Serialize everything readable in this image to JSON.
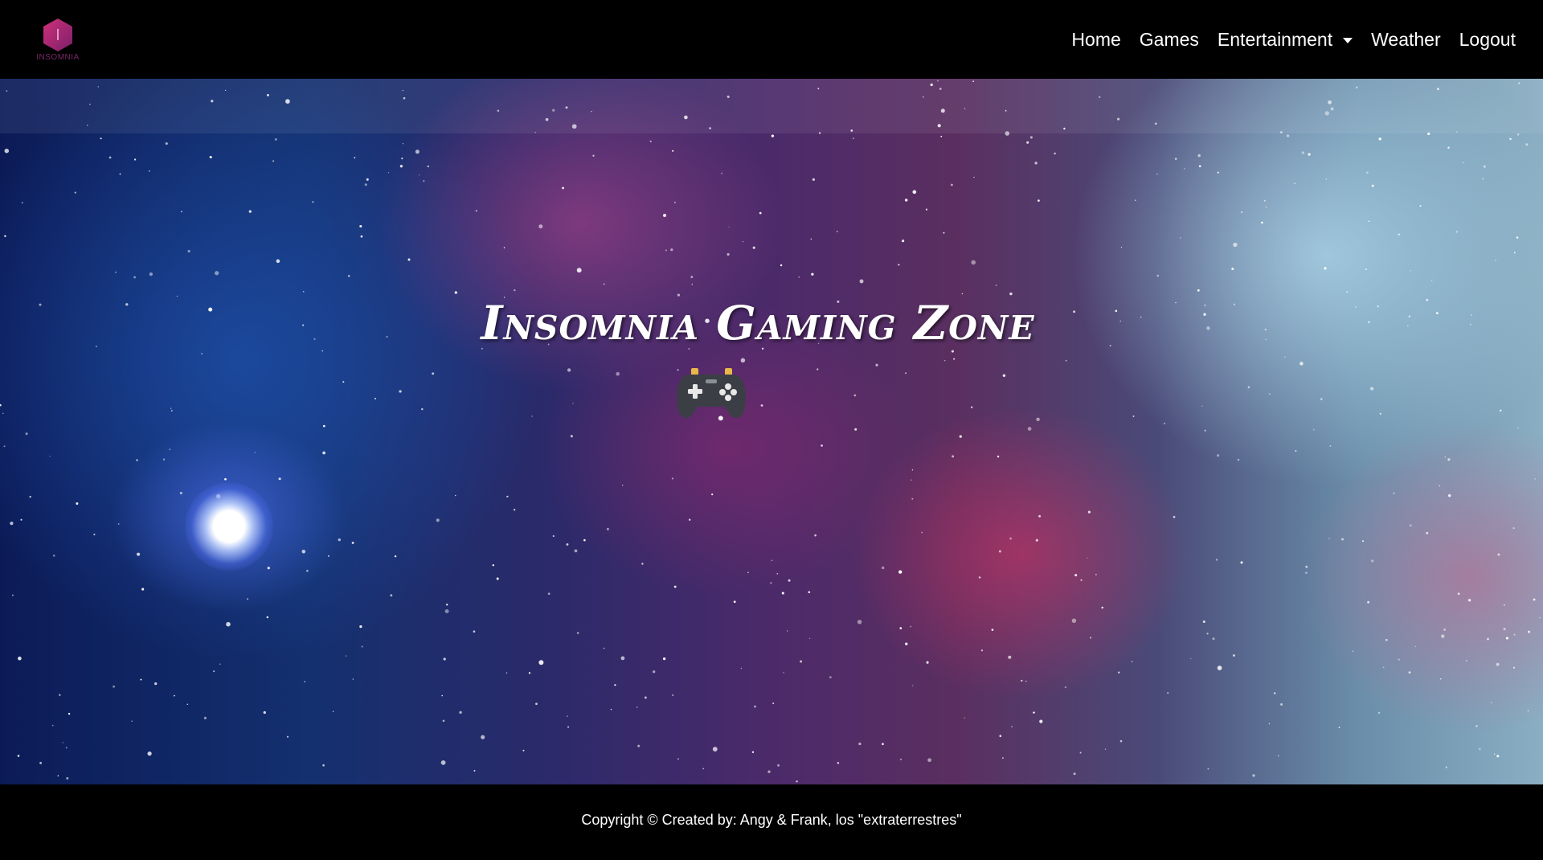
{
  "navbar": {
    "brand_text": "INSOMNIA",
    "logo_icon": "hexagon-logo-icon",
    "links": [
      {
        "label": "Home"
      },
      {
        "label": "Games"
      },
      {
        "label": "Entertainment"
      },
      {
        "label": "Weather"
      },
      {
        "label": "Logout"
      }
    ],
    "dropdown_icon": "caret-down-icon"
  },
  "hero": {
    "title": "Insomnia Gaming Zone",
    "icon": "game-controller-icon"
  },
  "footer": {
    "copyright": "Copyright © Created by: Angy & Frank, los \"extraterrestres\""
  },
  "colors": {
    "nav_background": "#000000",
    "text": "#ffffff",
    "logo_accent": "#b0236e"
  }
}
